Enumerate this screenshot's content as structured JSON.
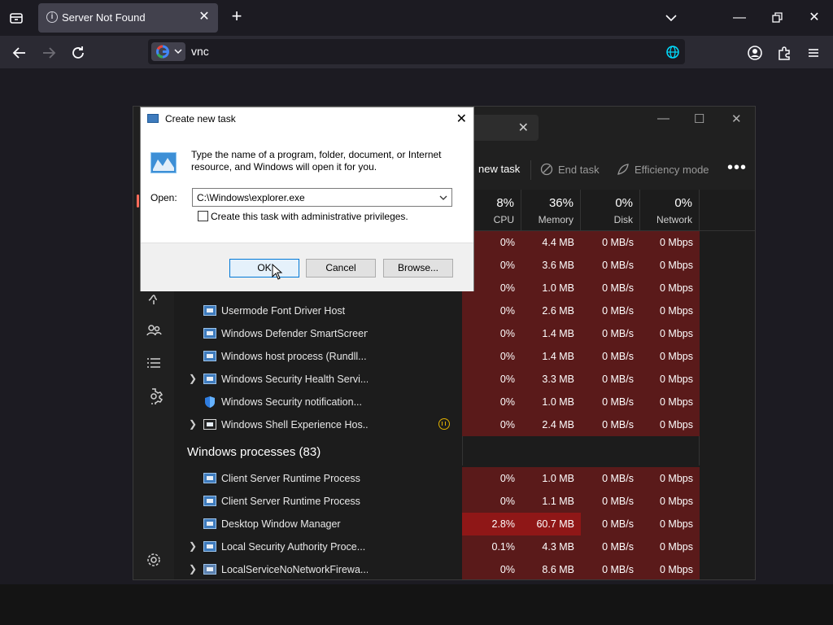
{
  "browser": {
    "tab_title": "Server Not Found",
    "url_text": "vnc",
    "icons": [
      "tab-list-icon",
      "info-icon",
      "close-icon",
      "plus-icon",
      "chevron-down-icon",
      "minimize-icon",
      "restore-icon",
      "close-icon",
      "back-icon",
      "forward-icon",
      "reload-icon",
      "google-icon",
      "globe-icon",
      "account-icon",
      "extensions-icon",
      "menu-icon"
    ]
  },
  "taskmgr": {
    "commands": {
      "run_new_task": "new task",
      "end_task": "End task",
      "efficiency_mode": "Efficiency mode"
    },
    "headers": [
      {
        "pct": "8%",
        "name": "CPU"
      },
      {
        "pct": "36%",
        "name": "Memory"
      },
      {
        "pct": "0%",
        "name": "Disk"
      },
      {
        "pct": "0%",
        "name": "Network"
      }
    ],
    "top_rows": [
      {
        "cpu": "0%",
        "mem": "4.4 MB",
        "disk": "0 MB/s",
        "net": "0 Mbps"
      },
      {
        "cpu": "0%",
        "mem": "3.6 MB",
        "disk": "0 MB/s",
        "net": "0 Mbps"
      },
      {
        "cpu": "0%",
        "mem": "1.0 MB",
        "disk": "0 MB/s",
        "net": "0 Mbps"
      }
    ],
    "rows": [
      {
        "name": "Usermode Font Driver Host",
        "cpu": "0%",
        "mem": "2.6 MB",
        "disk": "0 MB/s",
        "net": "0 Mbps"
      },
      {
        "name": "Windows Defender SmartScreen",
        "cpu": "0%",
        "mem": "1.4 MB",
        "disk": "0 MB/s",
        "net": "0 Mbps"
      },
      {
        "name": "Windows host process (Rundll...",
        "cpu": "0%",
        "mem": "1.4 MB",
        "disk": "0 MB/s",
        "net": "0 Mbps"
      },
      {
        "name": "Windows Security Health Servi...",
        "cpu": "0%",
        "mem": "3.3 MB",
        "disk": "0 MB/s",
        "net": "0 Mbps"
      },
      {
        "name": "Windows Security notification...",
        "cpu": "0%",
        "mem": "1.0 MB",
        "disk": "0 MB/s",
        "net": "0 Mbps"
      },
      {
        "name": "Windows Shell Experience Hos...",
        "cpu": "0%",
        "mem": "2.4 MB",
        "disk": "0 MB/s",
        "net": "0 Mbps"
      }
    ],
    "group_title": "Windows processes (83)",
    "win_rows": [
      {
        "name": "Client Server Runtime Process",
        "cpu": "0%",
        "mem": "1.0 MB",
        "disk": "0 MB/s",
        "net": "0 Mbps"
      },
      {
        "name": "Client Server Runtime Process",
        "cpu": "0%",
        "mem": "1.1 MB",
        "disk": "0 MB/s",
        "net": "0 Mbps"
      },
      {
        "name": "Desktop Window Manager",
        "cpu": "2.8%",
        "mem": "60.7 MB",
        "disk": "0 MB/s",
        "net": "0 Mbps"
      },
      {
        "name": "Local Security Authority Proce...",
        "cpu": "0.1%",
        "mem": "4.3 MB",
        "disk": "0 MB/s",
        "net": "0 Mbps"
      },
      {
        "name": "LocalServiceNoNetworkFirewa...",
        "cpu": "0%",
        "mem": "8.6 MB",
        "disk": "0 MB/s",
        "net": "0 Mbps"
      }
    ],
    "colors": {
      "cell_normal": "#5a1a1a",
      "cell_hot": "#8f1717"
    }
  },
  "dialog": {
    "title": "Create new task",
    "message": "Type the name of a program, folder, document, or Internet resource, and Windows will open it for you.",
    "open_label": "Open:",
    "open_value": "C:\\Windows\\explorer.exe",
    "admin_checkbox_label": "Create this task with administrative privileges.",
    "ok": "OK",
    "cancel": "Cancel",
    "browse": "Browse..."
  }
}
